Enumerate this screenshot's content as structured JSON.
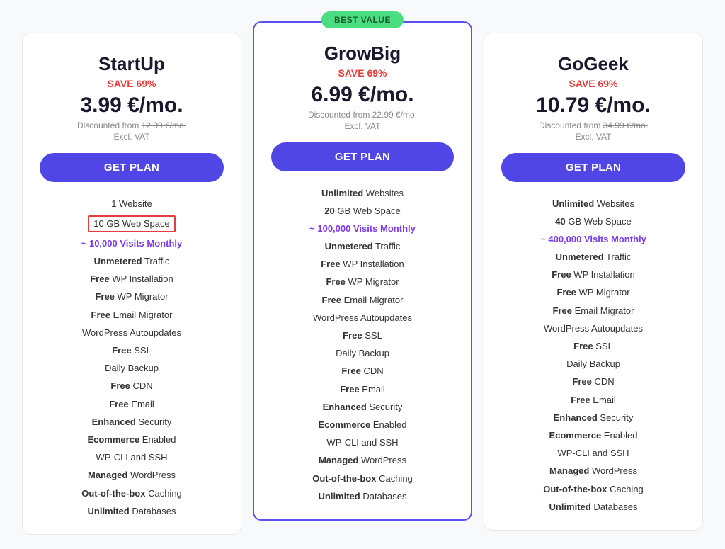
{
  "plans": [
    {
      "id": "startup",
      "name": "StartUp",
      "save": "SAVE 69%",
      "price": "3.99 €/mo.",
      "discounted_from": "12.99 €/mo.",
      "excl_vat": "Excl. VAT",
      "get_plan_label": "GET PLAN",
      "best_value": false,
      "features": [
        {
          "text": "1 Website",
          "bold_prefix": ""
        },
        {
          "text": "10 GB Web Space",
          "highlight_box": true
        },
        {
          "text": "~ 10,000 Visits Monthly",
          "visits": true
        },
        {
          "text": "Unmetered Traffic",
          "bold_prefix": "Unmetered"
        },
        {
          "text": "Free WP Installation",
          "bold_prefix": "Free"
        },
        {
          "text": "Free WP Migrator",
          "bold_prefix": "Free"
        },
        {
          "text": "Free Email Migrator",
          "bold_prefix": "Free"
        },
        {
          "text": "WordPress Autoupdates",
          "bold_prefix": ""
        },
        {
          "text": "Free SSL",
          "bold_prefix": "Free"
        },
        {
          "text": "Daily Backup",
          "bold_prefix": ""
        },
        {
          "text": "Free CDN",
          "bold_prefix": "Free"
        },
        {
          "text": "Free Email",
          "bold_prefix": "Free"
        },
        {
          "text": "Enhanced Security",
          "bold_prefix": "Enhanced"
        },
        {
          "text": "Ecommerce Enabled",
          "bold_prefix": "Ecommerce"
        },
        {
          "text": "WP-CLI and SSH",
          "bold_prefix": ""
        },
        {
          "text": "Managed WordPress",
          "bold_prefix": "Managed"
        },
        {
          "text": "Out-of-the-box Caching",
          "bold_prefix": "Out-of-the-box"
        },
        {
          "text": "Unlimited Databases",
          "bold_prefix": "Unlimited"
        }
      ]
    },
    {
      "id": "growbig",
      "name": "GrowBig",
      "save": "SAVE 69%",
      "price": "6.99 €/mo.",
      "discounted_from": "22.99 €/mo.",
      "excl_vat": "Excl. VAT",
      "get_plan_label": "GET PLAN",
      "best_value": true,
      "best_value_label": "BEST VALUE",
      "features": [
        {
          "text": "Unlimited Websites",
          "unlimited": true
        },
        {
          "text": "20 GB Web Space",
          "bold_prefix": "20"
        },
        {
          "text": "~ 100,000 Visits Monthly",
          "visits": true
        },
        {
          "text": "Unmetered Traffic",
          "bold_prefix": "Unmetered"
        },
        {
          "text": "Free WP Installation",
          "bold_prefix": "Free"
        },
        {
          "text": "Free WP Migrator",
          "bold_prefix": "Free"
        },
        {
          "text": "Free Email Migrator",
          "bold_prefix": "Free"
        },
        {
          "text": "WordPress Autoupdates",
          "bold_prefix": ""
        },
        {
          "text": "Free SSL",
          "bold_prefix": "Free"
        },
        {
          "text": "Daily Backup",
          "bold_prefix": ""
        },
        {
          "text": "Free CDN",
          "bold_prefix": "Free"
        },
        {
          "text": "Free Email",
          "bold_prefix": "Free"
        },
        {
          "text": "Enhanced Security",
          "bold_prefix": "Enhanced"
        },
        {
          "text": "Ecommerce Enabled",
          "bold_prefix": "Ecommerce"
        },
        {
          "text": "WP-CLI and SSH",
          "bold_prefix": ""
        },
        {
          "text": "Managed WordPress",
          "bold_prefix": "Managed"
        },
        {
          "text": "Out-of-the-box Caching",
          "bold_prefix": "Out-of-the-box"
        },
        {
          "text": "Unlimited Databases",
          "bold_prefix": "Unlimited"
        }
      ]
    },
    {
      "id": "gogeek",
      "name": "GoGeek",
      "save": "SAVE 69%",
      "price": "10.79 €/mo.",
      "discounted_from": "34.99 €/mo.",
      "excl_vat": "Excl. VAT",
      "get_plan_label": "GET PLAN",
      "best_value": false,
      "features": [
        {
          "text": "Unlimited Websites",
          "unlimited": true
        },
        {
          "text": "40 GB Web Space",
          "bold_prefix": "40"
        },
        {
          "text": "~ 400,000 Visits Monthly",
          "visits": true
        },
        {
          "text": "Unmetered Traffic",
          "bold_prefix": "Unmetered"
        },
        {
          "text": "Free WP Installation",
          "bold_prefix": "Free"
        },
        {
          "text": "Free WP Migrator",
          "bold_prefix": "Free"
        },
        {
          "text": "Free Email Migrator",
          "bold_prefix": "Free"
        },
        {
          "text": "WordPress Autoupdates",
          "bold_prefix": ""
        },
        {
          "text": "Free SSL",
          "bold_prefix": "Free"
        },
        {
          "text": "Daily Backup",
          "bold_prefix": ""
        },
        {
          "text": "Free CDN",
          "bold_prefix": "Free"
        },
        {
          "text": "Free Email",
          "bold_prefix": "Free"
        },
        {
          "text": "Enhanced Security",
          "bold_prefix": "Enhanced"
        },
        {
          "text": "Ecommerce Enabled",
          "bold_prefix": "Ecommerce"
        },
        {
          "text": "WP-CLI and SSH",
          "bold_prefix": ""
        },
        {
          "text": "Managed WordPress",
          "bold_prefix": "Managed"
        },
        {
          "text": "Out-of-the-box Caching",
          "bold_prefix": "Out-of-the-box"
        },
        {
          "text": "Unlimited Databases",
          "bold_prefix": "Unlimited"
        }
      ]
    }
  ]
}
